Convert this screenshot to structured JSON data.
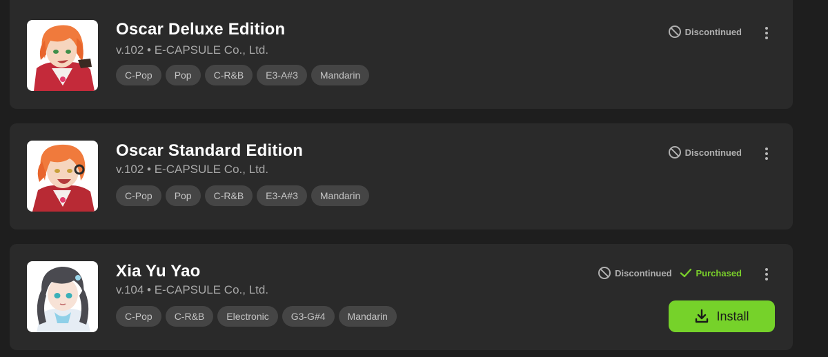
{
  "voicebanks": [
    {
      "name": "Oscar Deluxe Edition",
      "meta": "v.102 • E-CAPSULE Co., Ltd.",
      "tags": [
        "C-Pop",
        "Pop",
        "C-R&B",
        "E3-A#3",
        "Mandarin"
      ],
      "status": "Discontinued",
      "avatar_icon": "orange-haired-boy-avatar"
    },
    {
      "name": "Oscar Standard Edition",
      "meta": "v.102 • E-CAPSULE Co., Ltd.",
      "tags": [
        "C-Pop",
        "Pop",
        "C-R&B",
        "E3-A#3",
        "Mandarin"
      ],
      "status": "Discontinued",
      "avatar_icon": "orange-haired-boy-avatar"
    },
    {
      "name": "Xia Yu Yao",
      "meta": "v.104 • E-CAPSULE Co., Ltd.",
      "tags": [
        "C-Pop",
        "C-R&B",
        "Electronic",
        "G3-G#4",
        "Mandarin"
      ],
      "status": "Discontinued",
      "purchased_label": "Purchased",
      "install_label": "Install",
      "avatar_icon": "dark-haired-girl-avatar"
    }
  ],
  "colors": {
    "background": "#1e1e1e",
    "card": "#2a2a2a",
    "tag": "#454545",
    "accent_green": "#76d22a",
    "purchased_green": "#7ad02a"
  },
  "icons": {
    "discontinued": "prohibited-icon",
    "purchased": "checkmark-icon",
    "more": "kebab-menu-icon",
    "install": "download-icon"
  }
}
